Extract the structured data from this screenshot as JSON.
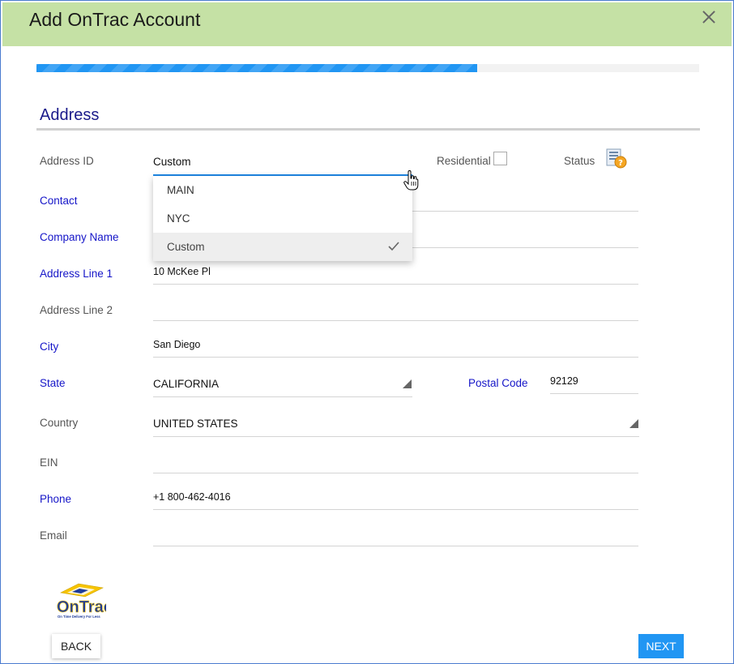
{
  "dialog": {
    "title": "Add OnTrac Account"
  },
  "progress": {
    "percent": 66.5
  },
  "section": {
    "title": "Address"
  },
  "address_id": {
    "label": "Address ID",
    "value": "Custom",
    "options": [
      "MAIN",
      "NYC",
      "Custom"
    ],
    "selected": "Custom"
  },
  "residential": {
    "label": "Residential",
    "checked": false
  },
  "status": {
    "label": "Status",
    "icon": "status-help-icon"
  },
  "fields": {
    "contact": {
      "label": "Contact",
      "value": ""
    },
    "company_name": {
      "label": "Company Name",
      "value": ""
    },
    "address_line1": {
      "label": "Address Line 1",
      "value": "10 McKee Pl"
    },
    "address_line2": {
      "label": "Address Line 2",
      "value": ""
    },
    "city": {
      "label": "City",
      "value": "San Diego"
    },
    "state": {
      "label": "State",
      "value": "CALIFORNIA"
    },
    "postal_code": {
      "label": "Postal Code",
      "value": "92129"
    },
    "country": {
      "label": "Country",
      "value": "UNITED STATES"
    },
    "ein": {
      "label": "EIN",
      "value": ""
    },
    "phone": {
      "label": "Phone",
      "value": "+1 800-462-4016"
    },
    "email": {
      "label": "Email",
      "value": ""
    }
  },
  "logo": {
    "name": "ontrac-logo",
    "brand_text": "OnTrac",
    "tagline": "On Time Delivery For Less"
  },
  "buttons": {
    "back": "BACK",
    "next": "NEXT"
  },
  "colors": {
    "header": "#c5e1a5",
    "accent": "#2196f3",
    "required_label": "#1515c8"
  }
}
